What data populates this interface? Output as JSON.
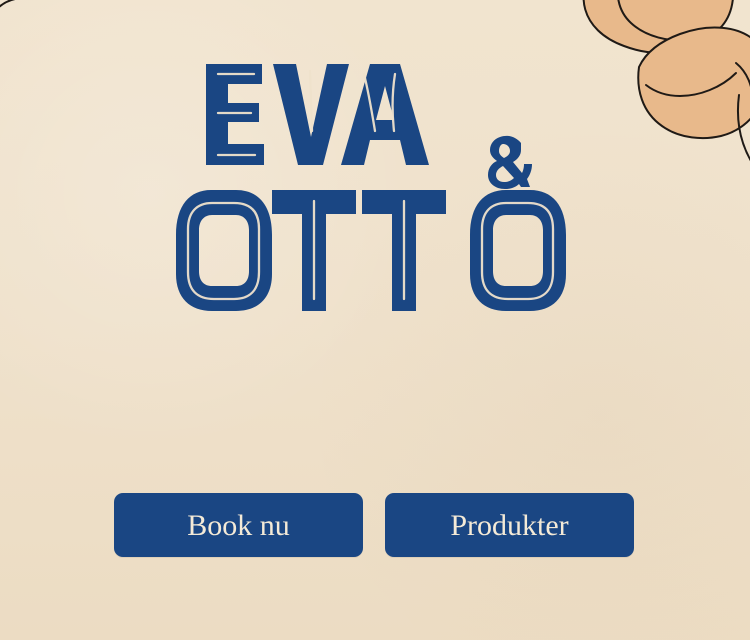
{
  "brand": {
    "name": "EVA & OTTO"
  },
  "actions": {
    "book_label": "Book nu",
    "products_label": "Produkter"
  },
  "colors": {
    "background": "#efe2cc",
    "primary": "#1a4683",
    "button_text": "#f4ead7",
    "accent": "#e8b98b",
    "outline": "#1f1a16"
  },
  "icons": {
    "decor_top_left": "decorative-shape-icon",
    "decor_top_right": "illustration-leaves-icon"
  }
}
